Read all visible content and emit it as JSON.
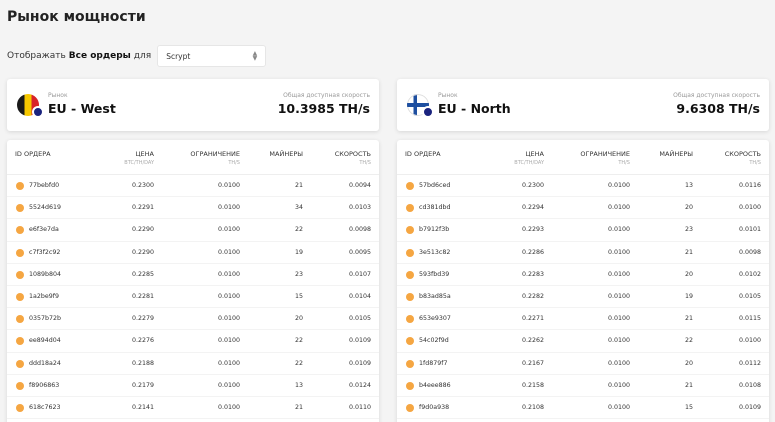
{
  "page_title": "Рынок мощности",
  "filter": {
    "prefix": "Отображать",
    "bold": "Все ордеры",
    "suffix": "для",
    "algorithm": "Scrypt"
  },
  "markets": [
    {
      "label": "Рынок",
      "name": "EU - West",
      "speed_label": "Общая доступная скорость",
      "speed": "10.3985 TH/s",
      "flag_colors": [
        "#1a1a1a",
        "#f6c800",
        "#d8232a"
      ],
      "columns": {
        "id": "ID ОРДЕРА",
        "price": "ЦЕНА",
        "price_unit": "BTC/TH/DAY",
        "limit": "ОГРАНИЧЕНИЕ",
        "limit_unit": "TH/S",
        "miners": "МАЙНЕРЫ",
        "speed": "СКОРОСТЬ",
        "speed_unit": "TH/S"
      },
      "rows": [
        {
          "id": "77bebfd0",
          "price": "0.2300",
          "limit": "0.0100",
          "miners": "21",
          "speed": "0.0094"
        },
        {
          "id": "5524d619",
          "price": "0.2291",
          "limit": "0.0100",
          "miners": "34",
          "speed": "0.0103"
        },
        {
          "id": "e6f3e7da",
          "price": "0.2290",
          "limit": "0.0100",
          "miners": "22",
          "speed": "0.0098"
        },
        {
          "id": "c7f3f2c92",
          "price": "0.2290",
          "limit": "0.0100",
          "miners": "19",
          "speed": "0.0095"
        },
        {
          "id": "1089b804",
          "price": "0.2285",
          "limit": "0.0100",
          "miners": "23",
          "speed": "0.0107"
        },
        {
          "id": "1a2be9f9",
          "price": "0.2281",
          "limit": "0.0100",
          "miners": "15",
          "speed": "0.0104"
        },
        {
          "id": "0357b72b",
          "price": "0.2279",
          "limit": "0.0100",
          "miners": "20",
          "speed": "0.0105"
        },
        {
          "id": "ee894d04",
          "price": "0.2276",
          "limit": "0.0100",
          "miners": "22",
          "speed": "0.0109"
        },
        {
          "id": "ddd18a24",
          "price": "0.2188",
          "limit": "0.0100",
          "miners": "22",
          "speed": "0.0109"
        },
        {
          "id": "f8906863",
          "price": "0.2179",
          "limit": "0.0100",
          "miners": "13",
          "speed": "0.0124"
        },
        {
          "id": "618c7623",
          "price": "0.2141",
          "limit": "0.0100",
          "miners": "21",
          "speed": "0.0110"
        }
      ]
    },
    {
      "label": "Рынок",
      "name": "EU - North",
      "speed_label": "Общая доступная скорость",
      "speed": "9.6308 TH/s",
      "flag_colors": [
        "#ffffff",
        "#1e4fa0"
      ],
      "columns": {
        "id": "ID ОРДЕРА",
        "price": "ЦЕНА",
        "price_unit": "BTC/TH/DAY",
        "limit": "ОГРАНИЧЕНИЕ",
        "limit_unit": "TH/S",
        "miners": "МАЙНЕРЫ",
        "speed": "СКОРОСТЬ",
        "speed_unit": "TH/S"
      },
      "rows": [
        {
          "id": "57bd6ced",
          "price": "0.2300",
          "limit": "0.0100",
          "miners": "13",
          "speed": "0.0116"
        },
        {
          "id": "cd381dbd",
          "price": "0.2294",
          "limit": "0.0100",
          "miners": "20",
          "speed": "0.0100"
        },
        {
          "id": "b7912f3b",
          "price": "0.2293",
          "limit": "0.0100",
          "miners": "23",
          "speed": "0.0101"
        },
        {
          "id": "3e513c82",
          "price": "0.2286",
          "limit": "0.0100",
          "miners": "21",
          "speed": "0.0098"
        },
        {
          "id": "593fbd39",
          "price": "0.2283",
          "limit": "0.0100",
          "miners": "20",
          "speed": "0.0102"
        },
        {
          "id": "b83ad85a",
          "price": "0.2282",
          "limit": "0.0100",
          "miners": "19",
          "speed": "0.0105"
        },
        {
          "id": "653e9307",
          "price": "0.2271",
          "limit": "0.0100",
          "miners": "21",
          "speed": "0.0115"
        },
        {
          "id": "54c02f9d",
          "price": "0.2262",
          "limit": "0.0100",
          "miners": "22",
          "speed": "0.0100"
        },
        {
          "id": "1fd879f7",
          "price": "0.2167",
          "limit": "0.0100",
          "miners": "20",
          "speed": "0.0112"
        },
        {
          "id": "b4eee886",
          "price": "0.2158",
          "limit": "0.0100",
          "miners": "21",
          "speed": "0.0108"
        },
        {
          "id": "f9d0a938",
          "price": "0.2108",
          "limit": "0.0100",
          "miners": "15",
          "speed": "0.0109"
        }
      ]
    }
  ]
}
